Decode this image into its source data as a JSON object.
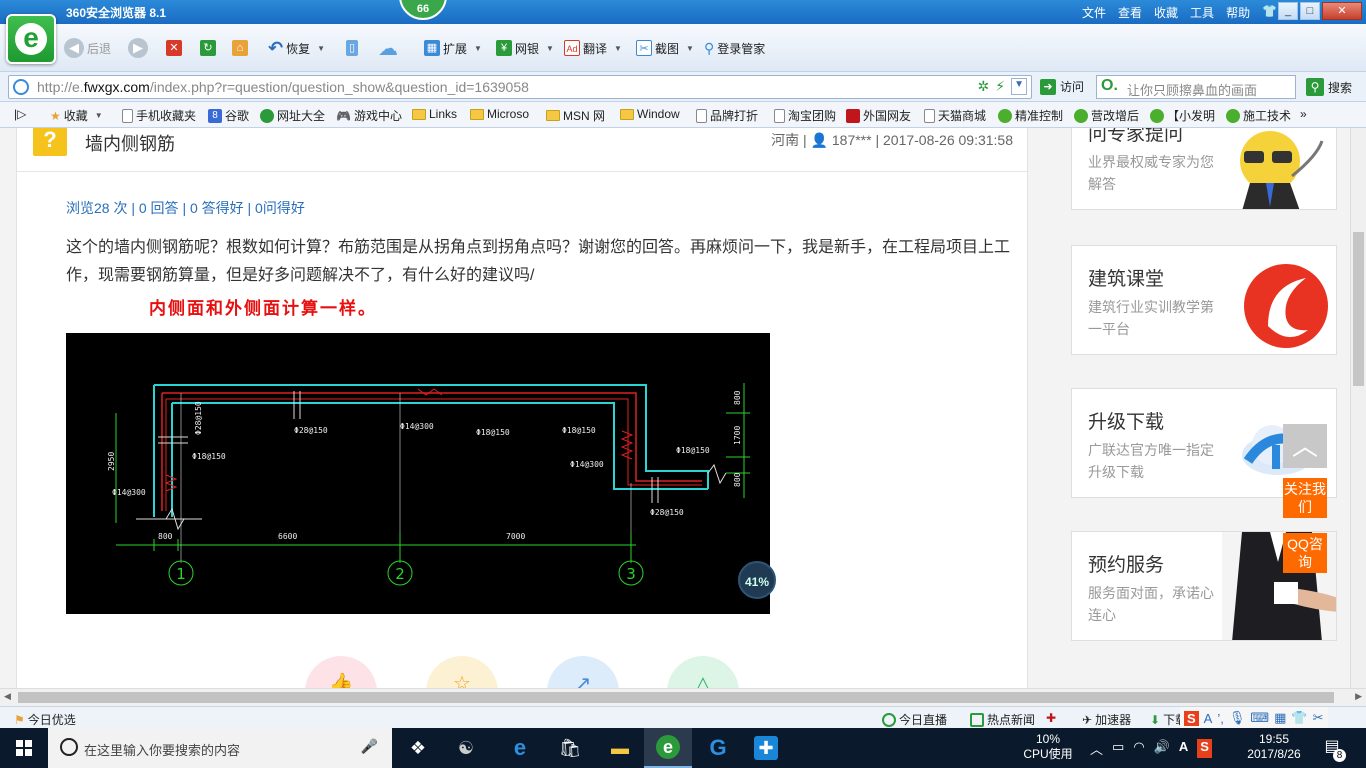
{
  "browser": {
    "title": "360安全浏览器 8.1",
    "badge": "66",
    "menu": [
      "文件",
      "查看",
      "收藏",
      "工具",
      "帮助"
    ],
    "win_min": "_",
    "win_max": "□",
    "win_close": "✕",
    "logo_letter": "e"
  },
  "toolbar": {
    "back": "后退",
    "restore": "恢复",
    "extend": "扩展",
    "bank": "网银",
    "translate": "翻译",
    "screenshot": "截图",
    "login": "登录管家"
  },
  "address": {
    "url_prefix": "http://e.",
    "url_host": "fwxgx.com",
    "url_path": "/index.php?r=question/question_show&question_id=1639058",
    "visit": "访问",
    "search_placeholder": "让你只顾擦鼻血的画面",
    "search_label": "搜索"
  },
  "favorites": [
    "收藏",
    "手机收藏夹",
    "谷歌",
    "网址大全",
    "游戏中心",
    "Links",
    "Microso",
    "MSN 网",
    "Window",
    "品牌打折",
    "淘宝团购",
    "外国网友",
    "天猫商城",
    "精准控制",
    "营改增后",
    "【小发明",
    "施工技术"
  ],
  "question": {
    "mark": "?",
    "title": "墙内侧钢筋",
    "meta": "河南 | 👤 187*** | 2017-08-26 09:31:58",
    "stats": "浏览28 次 | 0 回答 | 0 答得好 | 0问得好",
    "body": "这个的墙内侧钢筋呢？根数如何计算？布筋范围是从拐角点到拐角点吗？谢谢您的回答。再麻烦问一下，我是新手，在工程局项目上工作，现需要钢筋算量，但是好多问题解决不了，有什么好的建议吗/",
    "answer": "内侧面和外侧面计算一样。"
  },
  "cad": {
    "dims_bottom": [
      "800",
      "6600",
      "7000"
    ],
    "dim_left": "2950",
    "dims_right": [
      "800",
      "1700",
      "800"
    ],
    "axes": [
      "1",
      "2",
      "3"
    ],
    "labels": [
      "Φ28@150",
      "Φ28@150",
      "Φ18@150",
      "Φ14@300",
      "Φ28@150",
      "Φ14@300",
      "Φ18@150",
      "Φ18@150",
      "Φ28@150",
      "Φ14@300",
      "Φ18@150",
      "Φ28@150"
    ],
    "zoom": "41%"
  },
  "sidebar": {
    "cards": [
      {
        "title": "问专家提问",
        "desc": "业界最权威专家为您解答"
      },
      {
        "title": "建筑课堂",
        "desc": "建筑行业实训教学第一平台"
      },
      {
        "title": "升级下载",
        "desc": "广联达官方唯一指定升级下载"
      },
      {
        "title": "预约服务",
        "desc": "服务面对面，承诺心连心"
      }
    ],
    "follow": "关注我们",
    "qq": "QQ咨询",
    "top_icon": "︿"
  },
  "statusbar": {
    "left": "今日优选",
    "live": "今日直播",
    "news": "热点新闻",
    "accel": "加速器",
    "download": "下载"
  },
  "taskbar": {
    "search_placeholder": "在这里输入你要搜索的内容",
    "cpu_value": "10%",
    "cpu_label": "CPU使用",
    "time": "19:55",
    "date": "2017/8/26",
    "notif_count": "8"
  },
  "colors": {
    "accent": "#1a6cc2",
    "answer_red": "#e8100f",
    "orange": "#ff6a00",
    "link_blue": "#2a6ebb"
  }
}
